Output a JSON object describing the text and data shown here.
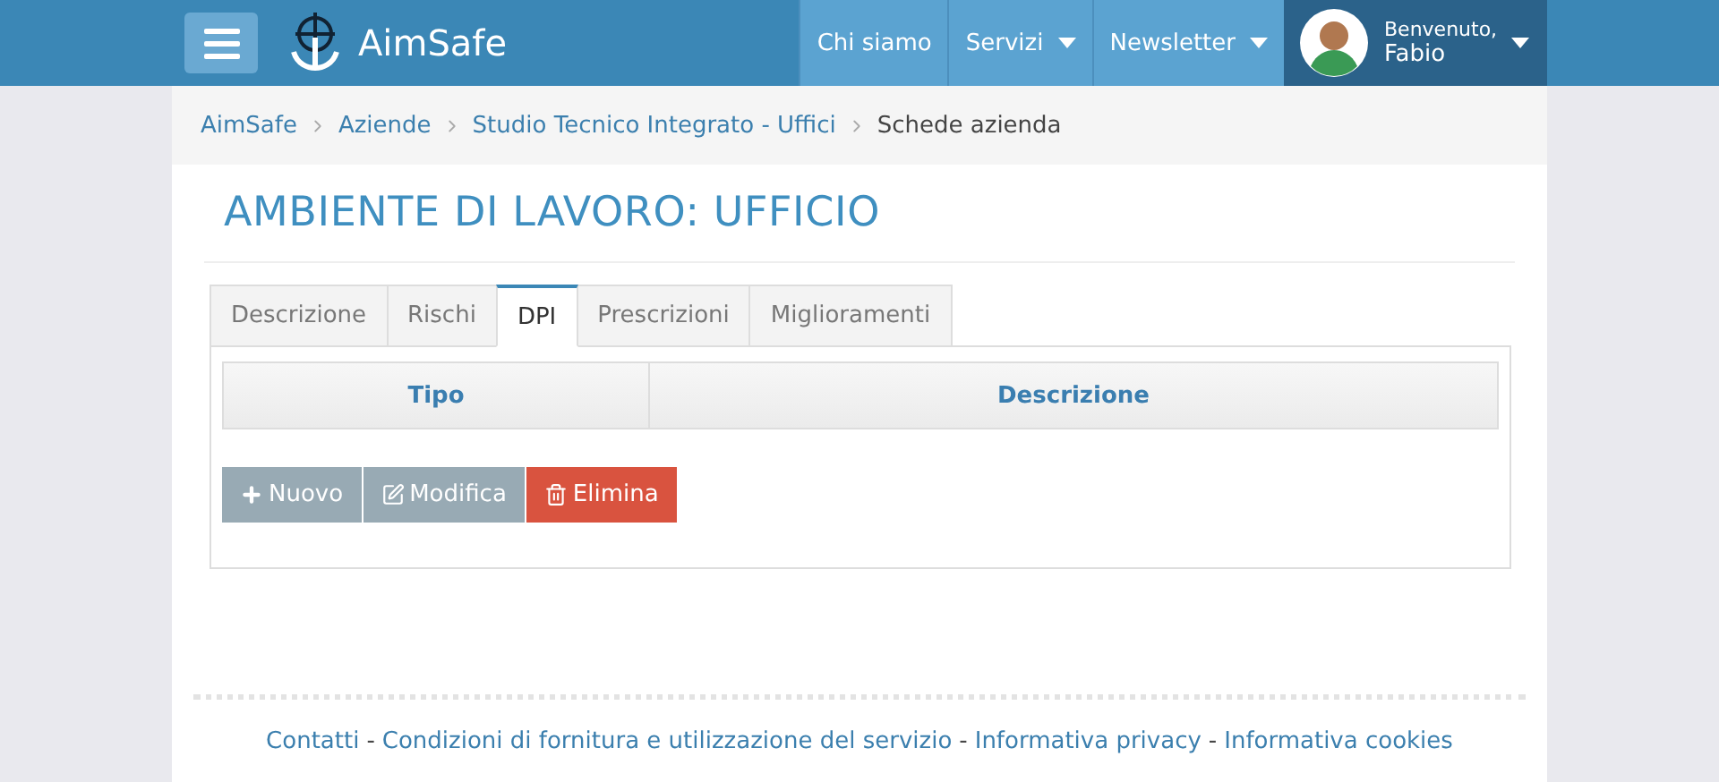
{
  "header": {
    "brand": "AimSafe",
    "nav": [
      {
        "label": "Chi siamo",
        "dropdown": false
      },
      {
        "label": "Servizi",
        "dropdown": true
      },
      {
        "label": "Newsletter",
        "dropdown": true
      }
    ],
    "user": {
      "greeting": "Benvenuto,",
      "name": "Fabio"
    }
  },
  "breadcrumb": [
    {
      "label": "AimSafe",
      "current": false
    },
    {
      "label": "Aziende",
      "current": false
    },
    {
      "label": "Studio Tecnico Integrato - Uffici",
      "current": false
    },
    {
      "label": "Schede azienda",
      "current": true
    }
  ],
  "title": "AMBIENTE DI LAVORO: UFFICIO",
  "tabs": [
    {
      "label": "Descrizione",
      "selected": false
    },
    {
      "label": "Rischi",
      "selected": false
    },
    {
      "label": "DPI",
      "selected": true
    },
    {
      "label": "Prescrizioni",
      "selected": false
    },
    {
      "label": "Miglioramenti",
      "selected": false
    }
  ],
  "table": {
    "columns": [
      "Tipo",
      "Descrizione"
    ]
  },
  "buttons": [
    {
      "label": "Nuovo",
      "kind": "new"
    },
    {
      "label": "Modifica",
      "kind": "edit"
    },
    {
      "label": "Elimina",
      "kind": "delete"
    }
  ],
  "footer": {
    "separator": "-",
    "links": [
      "Contatti",
      "Condizioni di fornitura e utilizzazione del servizio",
      "Informativa privacy",
      "Informativa cookies"
    ]
  }
}
